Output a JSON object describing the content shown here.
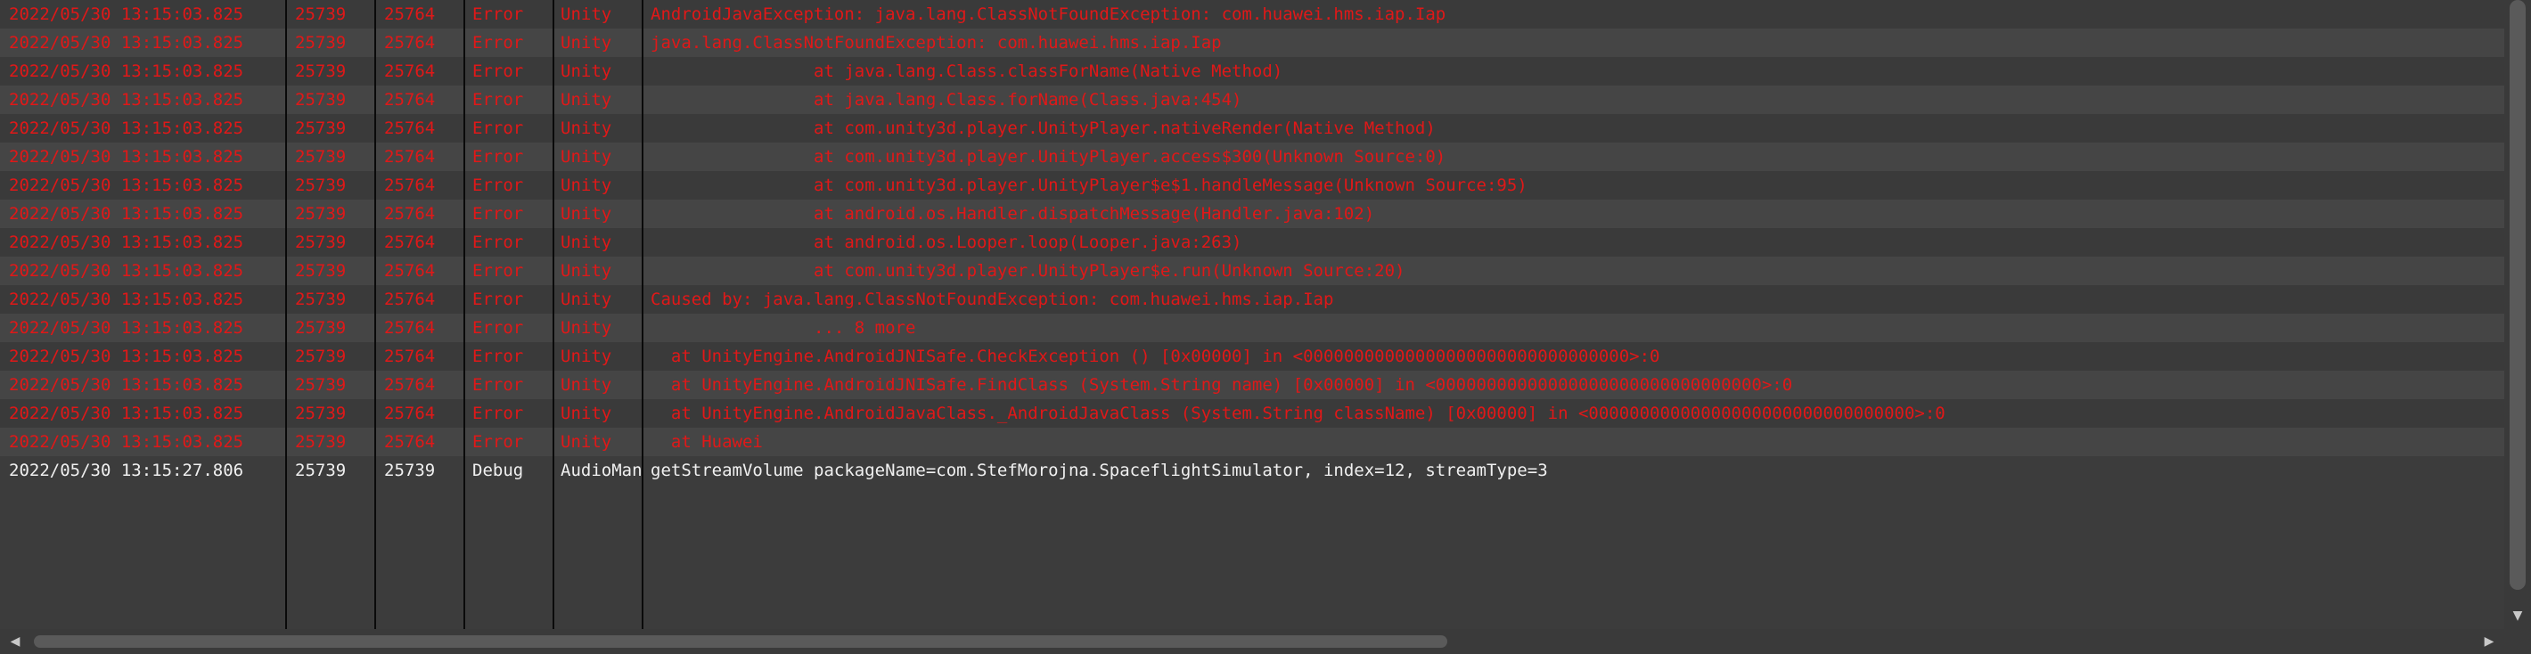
{
  "log": {
    "rows": [
      {
        "timestamp": "2022/05/30 13:15:03.825",
        "pid": "25739",
        "tid": "25764",
        "level": "Error",
        "tag": "Unity",
        "message": "AndroidJavaException: java.lang.ClassNotFoundException: com.huawei.hms.iap.Iap"
      },
      {
        "timestamp": "2022/05/30 13:15:03.825",
        "pid": "25739",
        "tid": "25764",
        "level": "Error",
        "tag": "Unity",
        "message": "java.lang.ClassNotFoundException: com.huawei.hms.iap.Iap"
      },
      {
        "timestamp": "2022/05/30 13:15:03.825",
        "pid": "25739",
        "tid": "25764",
        "level": "Error",
        "tag": "Unity",
        "message": "                at java.lang.Class.classForName(Native Method)"
      },
      {
        "timestamp": "2022/05/30 13:15:03.825",
        "pid": "25739",
        "tid": "25764",
        "level": "Error",
        "tag": "Unity",
        "message": "                at java.lang.Class.forName(Class.java:454)"
      },
      {
        "timestamp": "2022/05/30 13:15:03.825",
        "pid": "25739",
        "tid": "25764",
        "level": "Error",
        "tag": "Unity",
        "message": "                at com.unity3d.player.UnityPlayer.nativeRender(Native Method)"
      },
      {
        "timestamp": "2022/05/30 13:15:03.825",
        "pid": "25739",
        "tid": "25764",
        "level": "Error",
        "tag": "Unity",
        "message": "                at com.unity3d.player.UnityPlayer.access$300(Unknown Source:0)"
      },
      {
        "timestamp": "2022/05/30 13:15:03.825",
        "pid": "25739",
        "tid": "25764",
        "level": "Error",
        "tag": "Unity",
        "message": "                at com.unity3d.player.UnityPlayer$e$1.handleMessage(Unknown Source:95)"
      },
      {
        "timestamp": "2022/05/30 13:15:03.825",
        "pid": "25739",
        "tid": "25764",
        "level": "Error",
        "tag": "Unity",
        "message": "                at android.os.Handler.dispatchMessage(Handler.java:102)"
      },
      {
        "timestamp": "2022/05/30 13:15:03.825",
        "pid": "25739",
        "tid": "25764",
        "level": "Error",
        "tag": "Unity",
        "message": "                at android.os.Looper.loop(Looper.java:263)"
      },
      {
        "timestamp": "2022/05/30 13:15:03.825",
        "pid": "25739",
        "tid": "25764",
        "level": "Error",
        "tag": "Unity",
        "message": "                at com.unity3d.player.UnityPlayer$e.run(Unknown Source:20)"
      },
      {
        "timestamp": "2022/05/30 13:15:03.825",
        "pid": "25739",
        "tid": "25764",
        "level": "Error",
        "tag": "Unity",
        "message": "Caused by: java.lang.ClassNotFoundException: com.huawei.hms.iap.Iap"
      },
      {
        "timestamp": "2022/05/30 13:15:03.825",
        "pid": "25739",
        "tid": "25764",
        "level": "Error",
        "tag": "Unity",
        "message": "                ... 8 more"
      },
      {
        "timestamp": "2022/05/30 13:15:03.825",
        "pid": "25739",
        "tid": "25764",
        "level": "Error",
        "tag": "Unity",
        "message": "  at UnityEngine.AndroidJNISafe.CheckException () [0x00000] in <00000000000000000000000000000000>:0"
      },
      {
        "timestamp": "2022/05/30 13:15:03.825",
        "pid": "25739",
        "tid": "25764",
        "level": "Error",
        "tag": "Unity",
        "message": "  at UnityEngine.AndroidJNISafe.FindClass (System.String name) [0x00000] in <00000000000000000000000000000000>:0"
      },
      {
        "timestamp": "2022/05/30 13:15:03.825",
        "pid": "25739",
        "tid": "25764",
        "level": "Error",
        "tag": "Unity",
        "message": "  at UnityEngine.AndroidJavaClass._AndroidJavaClass (System.String className) [0x00000] in <00000000000000000000000000000000>:0"
      },
      {
        "timestamp": "2022/05/30 13:15:03.825",
        "pid": "25739",
        "tid": "25764",
        "level": "Error",
        "tag": "Unity",
        "message": "  at Huawei"
      },
      {
        "timestamp": "2022/05/30 13:15:27.806",
        "pid": "25739",
        "tid": "25739",
        "level": "Debug",
        "tag": "AudioMan",
        "message": "getStreamVolume packageName=com.StefMorojna.SpaceflightSimulator, index=12, streamType=3"
      }
    ]
  },
  "scrollbars": {
    "left_arrow": "◀",
    "right_arrow": "▶",
    "down_arrow": "▼"
  },
  "colors": {
    "error_text": "#e01818",
    "debug_text": "#f0f0f0",
    "background": "#3c3c3c",
    "column_separator": "#0a0a0a"
  }
}
